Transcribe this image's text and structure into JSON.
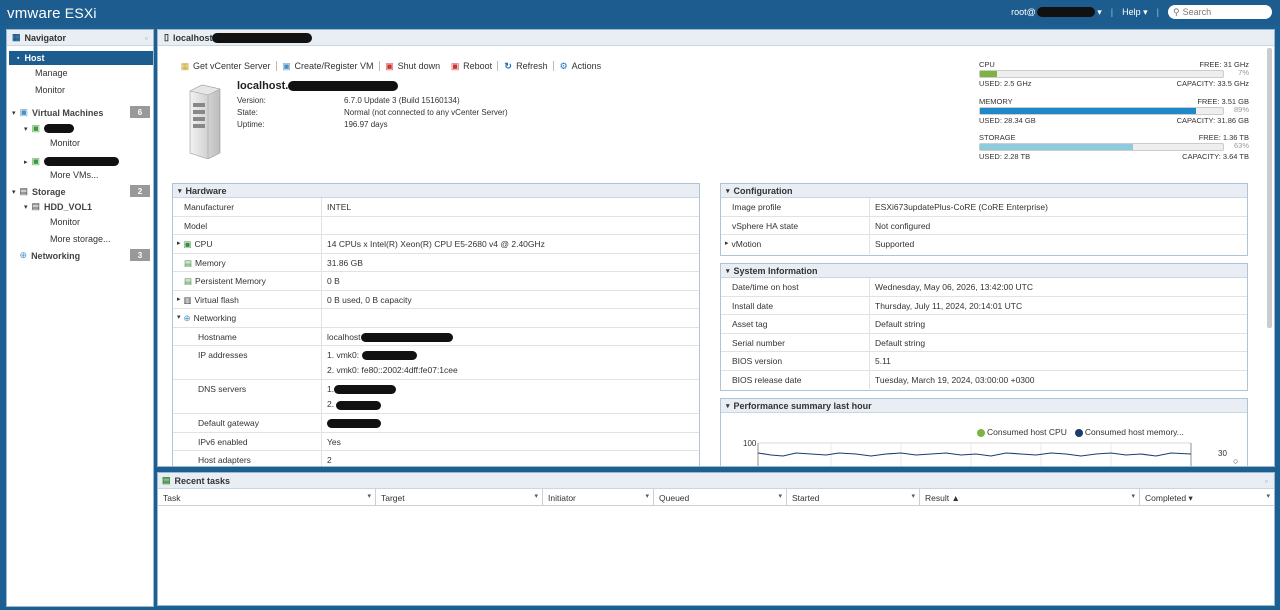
{
  "header": {
    "logo_vm": "vm",
    "logo_ware": "ware",
    "logo_esxi": " ESXi",
    "user": "root@",
    "help": "Help",
    "search_placeholder": "Search"
  },
  "navigator": {
    "title": "Navigator",
    "host": "Host",
    "manage": "Manage",
    "monitor": "Monitor",
    "vms": "Virtual Machines",
    "vms_count": "6",
    "vm1_monitor": "Monitor",
    "more_vms": "More VMs...",
    "storage": "Storage",
    "storage_count": "2",
    "datastore": "HDD_VOL1",
    "ds_monitor": "Monitor",
    "more_storage": "More storage...",
    "networking": "Networking",
    "net_count": "3"
  },
  "main": {
    "title": "localhost",
    "toolbar": {
      "get_vcenter": "Get vCenter Server",
      "create_vm": "Create/Register VM",
      "shutdown": "Shut down",
      "reboot": "Reboot",
      "refresh": "Refresh",
      "actions": "Actions"
    },
    "host_info": {
      "name": "localhost.",
      "version_label": "Version:",
      "version": "6.7.0 Update 3 (Build 15160134)",
      "state_label": "State:",
      "state": "Normal (not connected to any vCenter Server)",
      "uptime_label": "Uptime:",
      "uptime": "196.97 days"
    },
    "resources": {
      "cpu": {
        "label": "CPU",
        "free": "FREE: 31 GHz",
        "pct": "7%",
        "used": "USED: 2.5 GHz",
        "capacity": "CAPACITY: 33.5 GHz",
        "fill": 0.07,
        "color": "#7cb342"
      },
      "memory": {
        "label": "MEMORY",
        "free": "FREE: 3.51 GB",
        "pct": "89%",
        "used": "USED: 28.34 GB",
        "capacity": "CAPACITY: 31.86 GB",
        "fill": 0.89,
        "color": "#1e88c9"
      },
      "storage": {
        "label": "STORAGE",
        "free": "FREE: 1.36 TB",
        "pct": "63%",
        "used": "USED: 2.28 TB",
        "capacity": "CAPACITY: 3.64 TB",
        "fill": 0.63,
        "color": "#8fcbdc"
      }
    },
    "hardware": {
      "title": "Hardware",
      "manufacturer_k": "Manufacturer",
      "manufacturer_v": "INTEL",
      "model_k": "Model",
      "model_v": "",
      "cpu_k": "CPU",
      "cpu_v": "14 CPUs x Intel(R) Xeon(R) CPU E5-2680 v4 @ 2.40GHz",
      "memory_k": "Memory",
      "memory_v": "31.86 GB",
      "pmem_k": "Persistent Memory",
      "pmem_v": "0 B",
      "vflash_k": "Virtual flash",
      "vflash_v": "0 B used, 0 B capacity",
      "networking_k": "Networking",
      "hostname_k": "Hostname",
      "hostname_v": "localhost",
      "ip_k": "IP addresses",
      "ip_v1": "1. vmk0:",
      "ip_v2": "2. vmk0: fe80::2002:4dff:fe07:1cee",
      "dns_k": "DNS servers",
      "dns_v1": "1.",
      "dns_v2": "2.",
      "gw_k": "Default gateway",
      "ipv6_k": "IPv6 enabled",
      "ipv6_v": "Yes",
      "adapters_k": "Host adapters",
      "adapters_v": "2"
    },
    "configuration": {
      "title": "Configuration",
      "profile_k": "Image profile",
      "profile_v": "ESXi673updatePlus-CoRE (CoRE Enterprise)",
      "ha_k": "vSphere HA state",
      "ha_v": "Not configured",
      "vmotion_k": "vMotion",
      "vmotion_v": "Supported"
    },
    "system_info": {
      "title": "System Information",
      "dt_k": "Date/time on host",
      "dt_v": "Wednesday, May 06, 2026, 13:42:00 UTC",
      "install_k": "Install date",
      "install_v": "Thursday, July 11, 2024, 20:14:01 UTC",
      "asset_k": "Asset tag",
      "asset_v": "Default string",
      "serial_k": "Serial number",
      "serial_v": "Default string",
      "bios_k": "BIOS version",
      "bios_v": "5.11",
      "biosdate_k": "BIOS release date",
      "biosdate_v": "Tuesday, March 19, 2024, 03:00:00 +0300"
    },
    "performance": {
      "title": "Performance summary last hour",
      "legend_cpu": "Consumed host CPU",
      "legend_mem": "Consumed host memory...",
      "y_left": "100",
      "y_right": "30"
    }
  },
  "tasks": {
    "title": "Recent tasks",
    "columns": [
      "Task",
      "Target",
      "Initiator",
      "Queued",
      "Started",
      "Result ▲",
      "Completed ▾"
    ]
  }
}
